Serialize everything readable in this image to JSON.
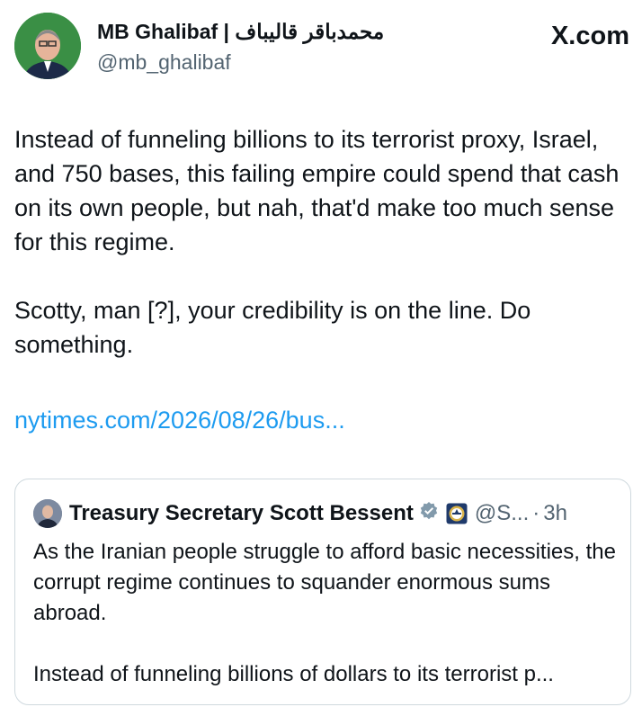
{
  "author": {
    "name": "MB Ghalibaf | محمدباقر قالیباف",
    "handle": "@mb_ghalibaf"
  },
  "source_label": "X.com",
  "post": {
    "paragraph_1": "Instead of funneling billions to its terrorist proxy, Israel, and 750 bases, this failing empire could spend that cash on its own people, but nah, that'd make too much sense for this regime.",
    "paragraph_2": "Scotty, man [?], your credibility is on the line. Do something.",
    "link": "nytimes.com/2026/08/26/bus..."
  },
  "quoted_post": {
    "author_name": "Treasury Secretary Scott Bessent",
    "handle": "@S...",
    "separator": "·",
    "time": "3h",
    "paragraph_1": "As the Iranian people struggle to afford basic necessities, the corrupt regime continues to squander enormous sums abroad.",
    "paragraph_2": "Instead of funneling billions of dollars to its terrorist p..."
  },
  "colors": {
    "text": "#0f1419",
    "secondary": "#536471",
    "link": "#1d9bf0",
    "border": "#cfd9de",
    "verified_badge": "#829aab"
  },
  "icons": [
    "verified-badge-icon",
    "treasury-seal-icon",
    "x-logo-icon"
  ]
}
